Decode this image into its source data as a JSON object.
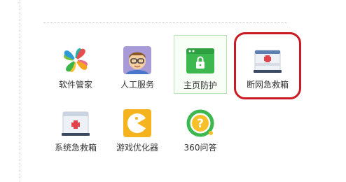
{
  "tools": [
    {
      "id": "software-manager",
      "label": "软件管家",
      "icon": "pinwheel-icon"
    },
    {
      "id": "human-service",
      "label": "人工服务",
      "icon": "person-glasses-icon"
    },
    {
      "id": "homepage-protect",
      "label": "主页防护",
      "icon": "browser-lock-icon"
    },
    {
      "id": "network-first-aid",
      "label": "断网急救箱",
      "icon": "network-firstaid-kit-icon"
    },
    {
      "id": "system-first-aid",
      "label": "系统急救箱",
      "icon": "firstaid-kit-icon"
    },
    {
      "id": "game-optimizer",
      "label": "游戏优化器",
      "icon": "pacman-icon"
    },
    {
      "id": "qa-360",
      "label": "360问答",
      "icon": "question-icon"
    }
  ],
  "colors": {
    "highlight": "#cc1a24",
    "selected_border": "#b7e3b7",
    "green": "#3cb84f",
    "label": "#333333"
  }
}
